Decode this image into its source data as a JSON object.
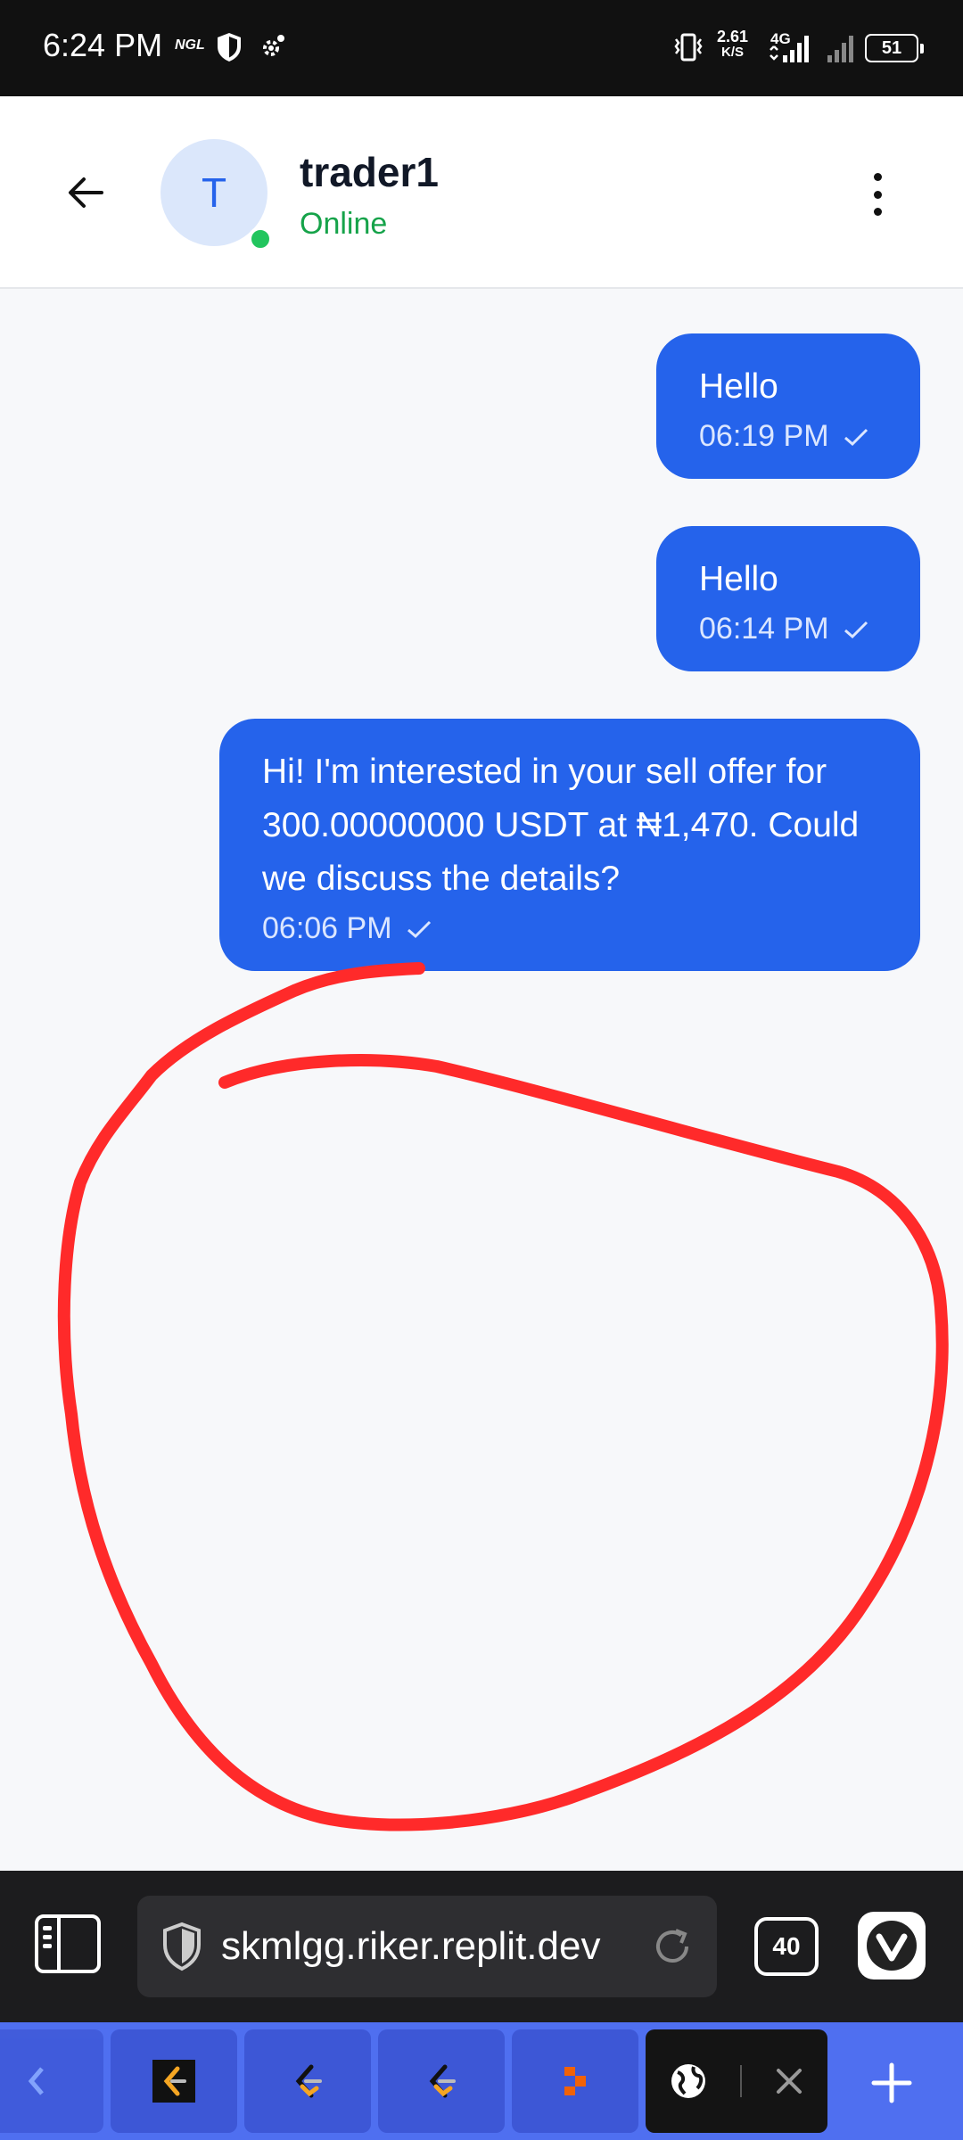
{
  "status_bar": {
    "time": "6:24 PM",
    "carrier_badge": "NGL",
    "net_speed_value": "2.61",
    "net_speed_unit": "K/S",
    "network_type": "4G",
    "battery": "51"
  },
  "header": {
    "avatar_initial": "T",
    "name": "trader1",
    "status": "Online"
  },
  "messages": [
    {
      "text": "Hello",
      "time": "06:19 PM",
      "status_icon": "check-icon"
    },
    {
      "text": "Hello",
      "time": "06:14 PM",
      "status_icon": "check-icon"
    },
    {
      "text": "Hi! I'm interested in your sell offer for 300.00000000 USDT at ₦1,470. Could we discuss the details?",
      "time": "06:06 PM",
      "status_icon": "check-icon"
    }
  ],
  "browser": {
    "url": "skmlgg.riker.replit.dev",
    "tab_count": "40"
  },
  "colors": {
    "bubble": "#2563eb",
    "online": "#22c55e",
    "annotation": "#ff2a2a",
    "tab_strip": "#4f6ff0"
  }
}
